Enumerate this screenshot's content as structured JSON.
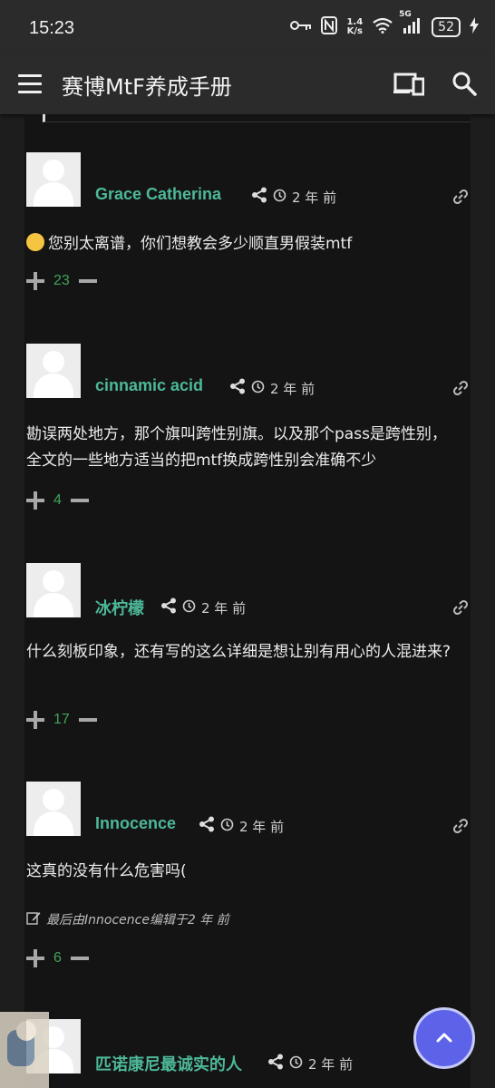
{
  "status_bar": {
    "time": "15:23",
    "speed_value": "1.4",
    "speed_unit": "K/s",
    "network": "5G",
    "battery": "52",
    "icons": [
      "key-icon",
      "nfc-icon",
      "wifi-icon",
      "signal-icon",
      "battery-icon",
      "charging-icon"
    ]
  },
  "app_bar": {
    "title": "赛博MtF养成手册",
    "icons": [
      "menu-icon",
      "devices-icon",
      "search-icon"
    ]
  },
  "comments": [
    {
      "username": "Grace Catherina",
      "time": "2 年 前",
      "text": "您别太离谱，你们想教会多少顺直男假装mtf",
      "emoji": "sweat-smile-emoji",
      "votes": "23"
    },
    {
      "username": "cinnamic acid",
      "time": "2 年 前",
      "text": "勘误两处地方，那个旗叫跨性别旗。以及那个pass是跨性别，全文的一些地方适当的把mtf换成跨性别会准确不少",
      "votes": "4"
    },
    {
      "username": "冰柠檬",
      "time": "2 年 前",
      "text": "什么刻板印象，还有写的这么详细是想让别有用心的人混进来?",
      "votes": "17"
    },
    {
      "username": "Innocence",
      "time": "2 年 前",
      "text": "这真的没有什么危害吗(",
      "edited": "最后由Innocence编辑于2 年 前",
      "votes": "6"
    },
    {
      "username": "匹诺康尼最诚实的人",
      "time": "2 年 前"
    }
  ],
  "colors": {
    "username": "#4db899",
    "vote_count": "#3fa35a",
    "fab": "#5c63e8",
    "background": "#141414"
  }
}
